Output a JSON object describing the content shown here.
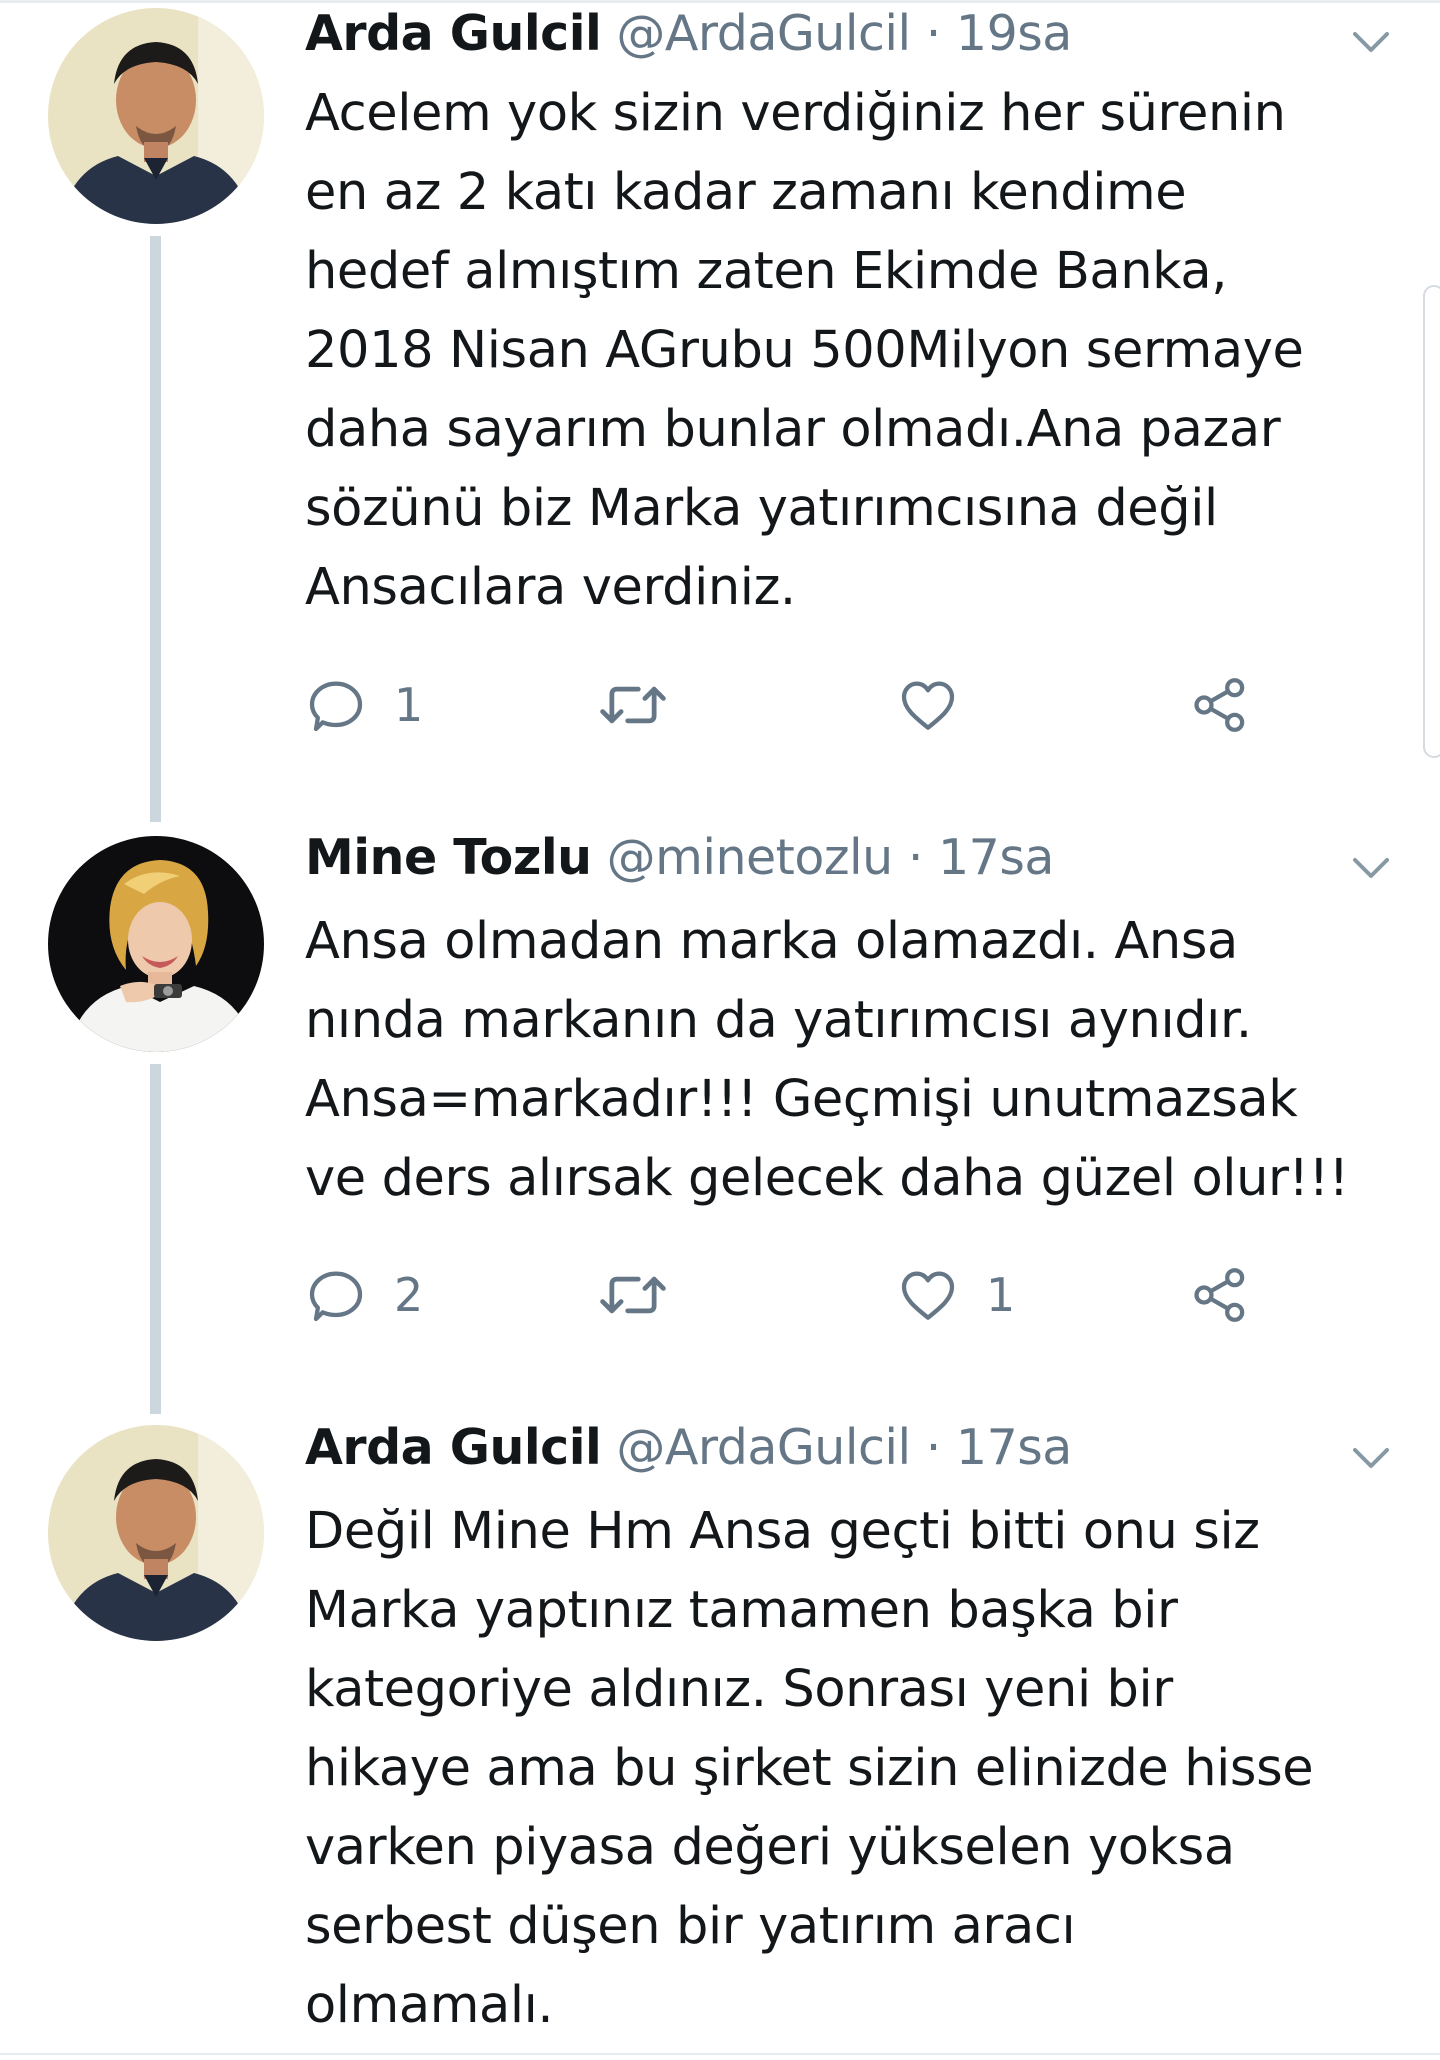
{
  "tweets": [
    {
      "name": "Arda Gulcil",
      "handle": "@ArdaGulcil",
      "separator": "·",
      "time": "19sa",
      "text_lines": [
        "Acelem yok sizin verdiğiniz her sürenin",
        "en az 2 katı kadar zamanı kendime",
        "hedef almıştım zaten Ekimde Banka,",
        "2018 Nisan AGrubu 500Milyon sermaye",
        "daha sayarım bunlar olmadı.Ana pazar",
        "sözünü biz Marka yatırımcısına değil",
        "Ansacılara verdiniz."
      ],
      "reply_count": "1",
      "retweet_count": "",
      "like_count": ""
    },
    {
      "name": "Mine Tozlu",
      "handle": "@minetozlu",
      "separator": "·",
      "time": "17sa",
      "text_lines": [
        "Ansa olmadan marka olamazdı. Ansa",
        "nında markanın da yatırımcısı aynıdır.",
        "Ansa=markadır!!! Geçmişi unutmazsak",
        "ve ders alırsak gelecek daha güzel olur!!!"
      ],
      "reply_count": "2",
      "retweet_count": "",
      "like_count": "1"
    },
    {
      "name": "Arda Gulcil",
      "handle": "@ArdaGulcil",
      "separator": "·",
      "time": "17sa",
      "text_lines": [
        "Değil Mine Hm Ansa geçti bitti onu siz",
        "Marka yaptınız tamamen başka bir",
        "kategoriye aldınız. Sonrası yeni bir",
        "hikaye ama bu şirket sizin elinizde hisse",
        "varken piyasa değeri yükselen yoksa",
        "serbest düşen bir yatırım aracı",
        "olmamalı."
      ]
    }
  ],
  "icons": {
    "reply": "reply-icon",
    "retweet": "retweet-icon",
    "like": "heart-icon",
    "share": "share-icon",
    "more": "chevron-down-icon"
  },
  "colors": {
    "text": "#14171a",
    "secondary": "#657786",
    "thread_line": "#ccd6dd",
    "border": "#e6ecf0"
  }
}
